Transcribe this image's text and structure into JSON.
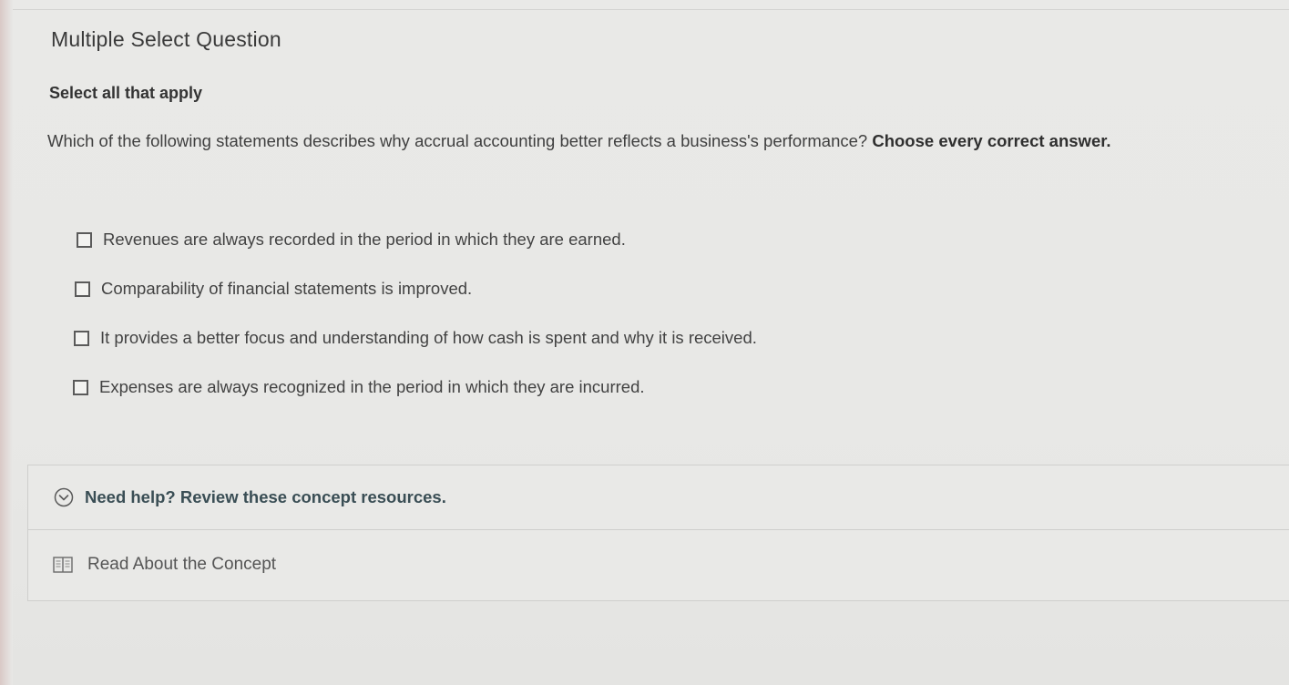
{
  "question": {
    "type_label": "Multiple Select Question",
    "instruction": "Select all that apply",
    "prompt": "Which of the following statements describes why accrual accounting better reflects a business's performance?",
    "prompt_emphasis": "Choose every correct answer.",
    "options": [
      {
        "label": "Revenues are always recorded in the period in which they are earned.",
        "checked": false
      },
      {
        "label": "Comparability of financial statements is improved.",
        "checked": false
      },
      {
        "label": "It provides a better focus and understanding of how cash is spent and why it is received.",
        "checked": false
      },
      {
        "label": "Expenses are always recognized in the period in which they are incurred.",
        "checked": false
      }
    ]
  },
  "help": {
    "header_label": "Need help? Review these concept resources.",
    "header_icon": "chevron-down-circle-icon",
    "resources": [
      {
        "icon": "book-icon",
        "label": "Read About the Concept"
      }
    ]
  },
  "colors": {
    "background": "#e8e8e6",
    "help_header_text": "#3a4e55"
  }
}
